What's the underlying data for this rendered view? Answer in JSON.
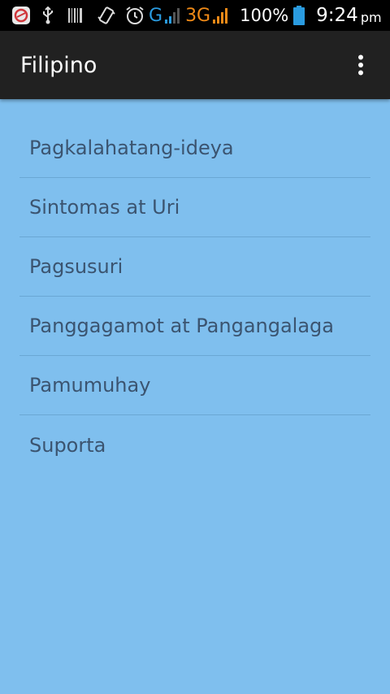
{
  "status_bar": {
    "network_g": "G",
    "network_3g": "3G",
    "battery": "100%",
    "time": "9:24",
    "time_suffix": "pm",
    "icons": [
      "app-notification-icon",
      "usb-icon",
      "barcode-icon",
      "vibrate-icon",
      "alarm-icon",
      "signal-icon",
      "battery-icon"
    ],
    "colors": {
      "g_color": "#2a9be0",
      "threeg_color": "#f08a17",
      "battery_color": "#2a9be0"
    }
  },
  "app_bar": {
    "title": "Filipino",
    "overflow_icon": "more-vert-icon"
  },
  "menu": {
    "items": [
      {
        "label": "Pagkalahatang-ideya"
      },
      {
        "label": "Sintomas at Uri"
      },
      {
        "label": "Pagsusuri"
      },
      {
        "label": "Panggagamot at Pangangalaga"
      },
      {
        "label": "Pamumuhay"
      },
      {
        "label": "Suporta"
      }
    ]
  },
  "colors": {
    "background": "#7fbfee",
    "app_bar": "#212121",
    "item_text": "#3b5470",
    "divider": "#6aa7d4"
  }
}
